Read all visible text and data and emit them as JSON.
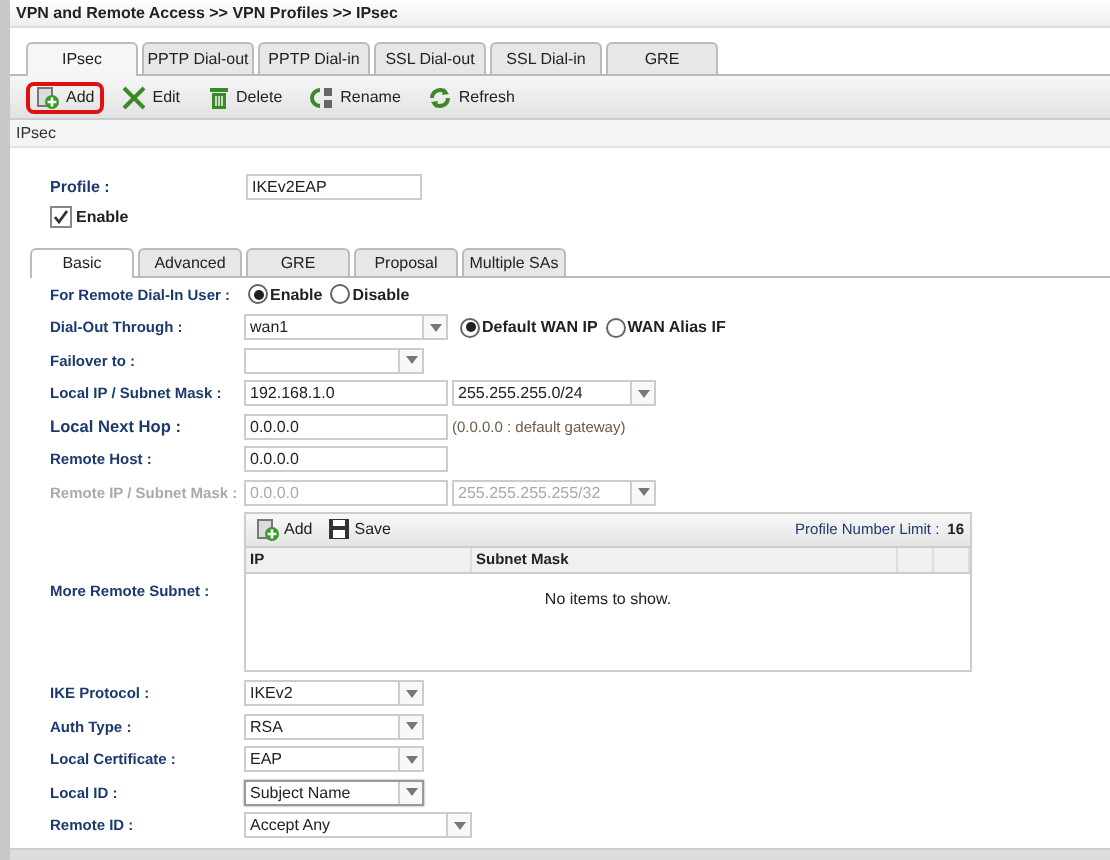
{
  "breadcrumb": "VPN and Remote Access >> VPN Profiles >> IPsec",
  "tabs": [
    {
      "label": "IPsec",
      "selected": true
    },
    {
      "label": "PPTP Dial-out",
      "selected": false
    },
    {
      "label": "PPTP Dial-in",
      "selected": false
    },
    {
      "label": "SSL Dial-out",
      "selected": false
    },
    {
      "label": "SSL Dial-in",
      "selected": false
    },
    {
      "label": "GRE",
      "selected": false
    }
  ],
  "toolbar": [
    {
      "kind": "add",
      "label": "Add",
      "highlighted": true
    },
    {
      "kind": "edit",
      "label": "Edit",
      "highlighted": false
    },
    {
      "kind": "delete",
      "label": "Delete",
      "highlighted": false
    },
    {
      "kind": "rename",
      "label": "Rename",
      "highlighted": false
    },
    {
      "kind": "refresh",
      "label": "Refresh",
      "highlighted": false
    }
  ],
  "section_title": "IPsec",
  "profile": {
    "label": "Profile :",
    "value": "IKEv2EAP"
  },
  "enable": {
    "label": "Enable",
    "checked": true
  },
  "subtabs": [
    {
      "label": "Basic",
      "selected": true
    },
    {
      "label": "Advanced",
      "selected": false
    },
    {
      "label": "GRE",
      "selected": false
    },
    {
      "label": "Proposal",
      "selected": false
    },
    {
      "label": "Multiple SAs",
      "selected": false
    }
  ],
  "rows": [
    {
      "kind": "radios",
      "label": "For Remote Dial-In User :",
      "options": [
        {
          "label": "Enable",
          "selected": true
        },
        {
          "label": "Disable",
          "selected": false
        }
      ]
    },
    {
      "kind": "select_radios",
      "label": "Dial-Out Through :",
      "value": "wan1",
      "options": [
        {
          "label": "Default WAN IP",
          "selected": true
        },
        {
          "label": "WAN Alias IF",
          "selected": false
        }
      ]
    },
    {
      "kind": "select",
      "label": "Failover to :",
      "value": ""
    },
    {
      "kind": "input_select",
      "label": "Local IP / Subnet Mask :",
      "value": "192.168.1.0",
      "mask": "255.255.255.0/24",
      "disabled": false
    },
    {
      "kind": "input_hint",
      "label": "Local Next Hop :",
      "value": "0.0.0.0",
      "hint": "(0.0.0.0 : default gateway)"
    },
    {
      "kind": "input",
      "label": "Remote Host :",
      "value": "0.0.0.0"
    },
    {
      "kind": "input_select",
      "label": "Remote IP / Subnet Mask :",
      "value": "0.0.0.0",
      "mask": "255.255.255.255/32",
      "disabled": true
    },
    {
      "kind": "table",
      "label": "More Remote Subnet :",
      "buttons": [
        {
          "kind": "add",
          "label": "Add"
        },
        {
          "kind": "save",
          "label": "Save"
        }
      ],
      "limit_label": "Profile Number Limit :",
      "limit": "16",
      "columns": [
        "IP",
        "Subnet Mask"
      ],
      "empty": "No items to show."
    },
    {
      "kind": "select",
      "label": "IKE Protocol :",
      "value": "IKEv2"
    },
    {
      "kind": "select",
      "label": "Auth Type :",
      "value": "RSA"
    },
    {
      "kind": "select",
      "label": "Local Certificate :",
      "value": "EAP"
    },
    {
      "kind": "select",
      "label": "Local ID :",
      "value": "Subject Name",
      "focused": true
    },
    {
      "kind": "wide_select",
      "label": "Remote ID :",
      "value": "Accept Any"
    }
  ]
}
